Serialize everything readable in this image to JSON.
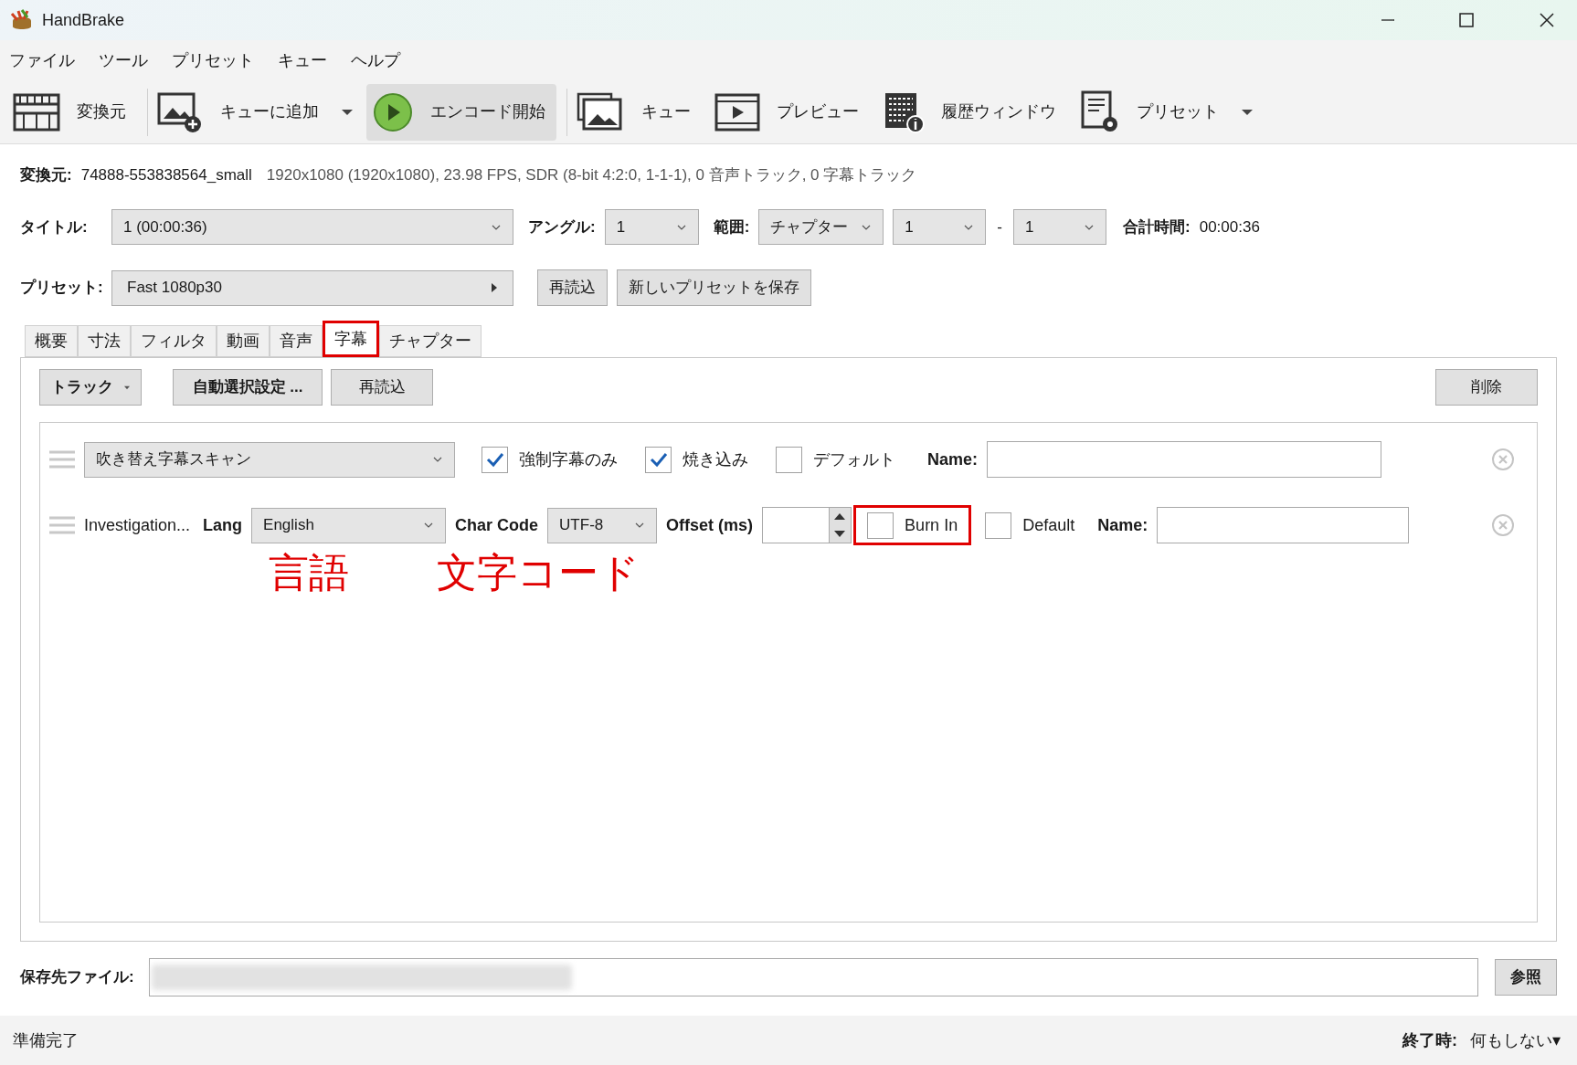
{
  "window": {
    "title": "HandBrake"
  },
  "menu": [
    "ファイル",
    "ツール",
    "プリセット",
    "キュー",
    "ヘルプ"
  ],
  "toolbar": [
    {
      "kind": "source",
      "label": "変換元",
      "dropdown": false,
      "active": false
    },
    {
      "kind": "add-queue",
      "label": "キューに追加",
      "dropdown": true,
      "active": false
    },
    {
      "kind": "start",
      "label": "エンコード開始",
      "dropdown": false,
      "active": true
    },
    {
      "kind": "queue",
      "label": "キュー",
      "dropdown": false,
      "active": false
    },
    {
      "kind": "preview",
      "label": "プレビュー",
      "dropdown": false,
      "active": false
    },
    {
      "kind": "log",
      "label": "履歴ウィンドウ",
      "dropdown": false,
      "active": false
    },
    {
      "kind": "presets",
      "label": "プリセット",
      "dropdown": true,
      "active": false
    }
  ],
  "source": {
    "label": "変換元:",
    "name": "74888-553838564_small",
    "info": "1920x1080 (1920x1080), 23.98 FPS, SDR (8-bit 4:2:0, 1-1-1), 0 音声トラック, 0 字幕トラック"
  },
  "title_row": {
    "title_label": "タイトル:",
    "title_value": "1  (00:00:36)",
    "angle_label": "アングル:",
    "angle_value": "1",
    "range_label": "範囲:",
    "range_value": "チャプター",
    "range_start": "1",
    "range_sep": "-",
    "range_end": "1",
    "duration_label": "合計時間:",
    "duration_value": "00:00:36"
  },
  "preset_row": {
    "label": "プリセット:",
    "value": "Fast 1080p30",
    "buttons": [
      "再読込",
      "新しいプリセットを保存"
    ]
  },
  "tabs": [
    {
      "label": "概要",
      "selected": false,
      "highlighted": false
    },
    {
      "label": "寸法",
      "selected": false,
      "highlighted": false
    },
    {
      "label": "フィルタ",
      "selected": false,
      "highlighted": false
    },
    {
      "label": "動画",
      "selected": false,
      "highlighted": false
    },
    {
      "label": "音声",
      "selected": false,
      "highlighted": false
    },
    {
      "label": "字幕",
      "selected": true,
      "highlighted": true
    },
    {
      "label": "チャプター",
      "selected": false,
      "highlighted": false
    }
  ],
  "subtitle_toolbar": {
    "track_button": "トラック",
    "auto_button": "自動選択設定 ...",
    "reload_button": "再読込",
    "remove_button": "削除"
  },
  "tracks": [
    {
      "kind": "scan",
      "select": "吹き替え字幕スキャン",
      "options": [
        {
          "label": "強制字幕のみ",
          "checked": true,
          "highlighted": false
        },
        {
          "label": "焼き込み",
          "checked": true,
          "highlighted": false
        },
        {
          "label": "デフォルト",
          "checked": false,
          "highlighted": false
        }
      ],
      "name_label": "Name:"
    },
    {
      "kind": "track",
      "source": "Investigation...",
      "lang_label": "Lang",
      "lang": "English",
      "charcode_label": "Char Code",
      "charcode": "UTF-8",
      "offset_label": "Offset (ms)",
      "options": [
        {
          "label": "Burn In",
          "checked": false,
          "highlighted": true
        },
        {
          "label": "Default",
          "checked": false,
          "highlighted": false
        }
      ],
      "name_label": "Name:"
    }
  ],
  "annotations": [
    "言語",
    "文字コード"
  ],
  "destination": {
    "label": "保存先ファイル:",
    "browse_button": "参照"
  },
  "status_bar": {
    "status": "準備完了",
    "when_done_label": "終了時:",
    "when_done_value": "何もしない▾"
  }
}
